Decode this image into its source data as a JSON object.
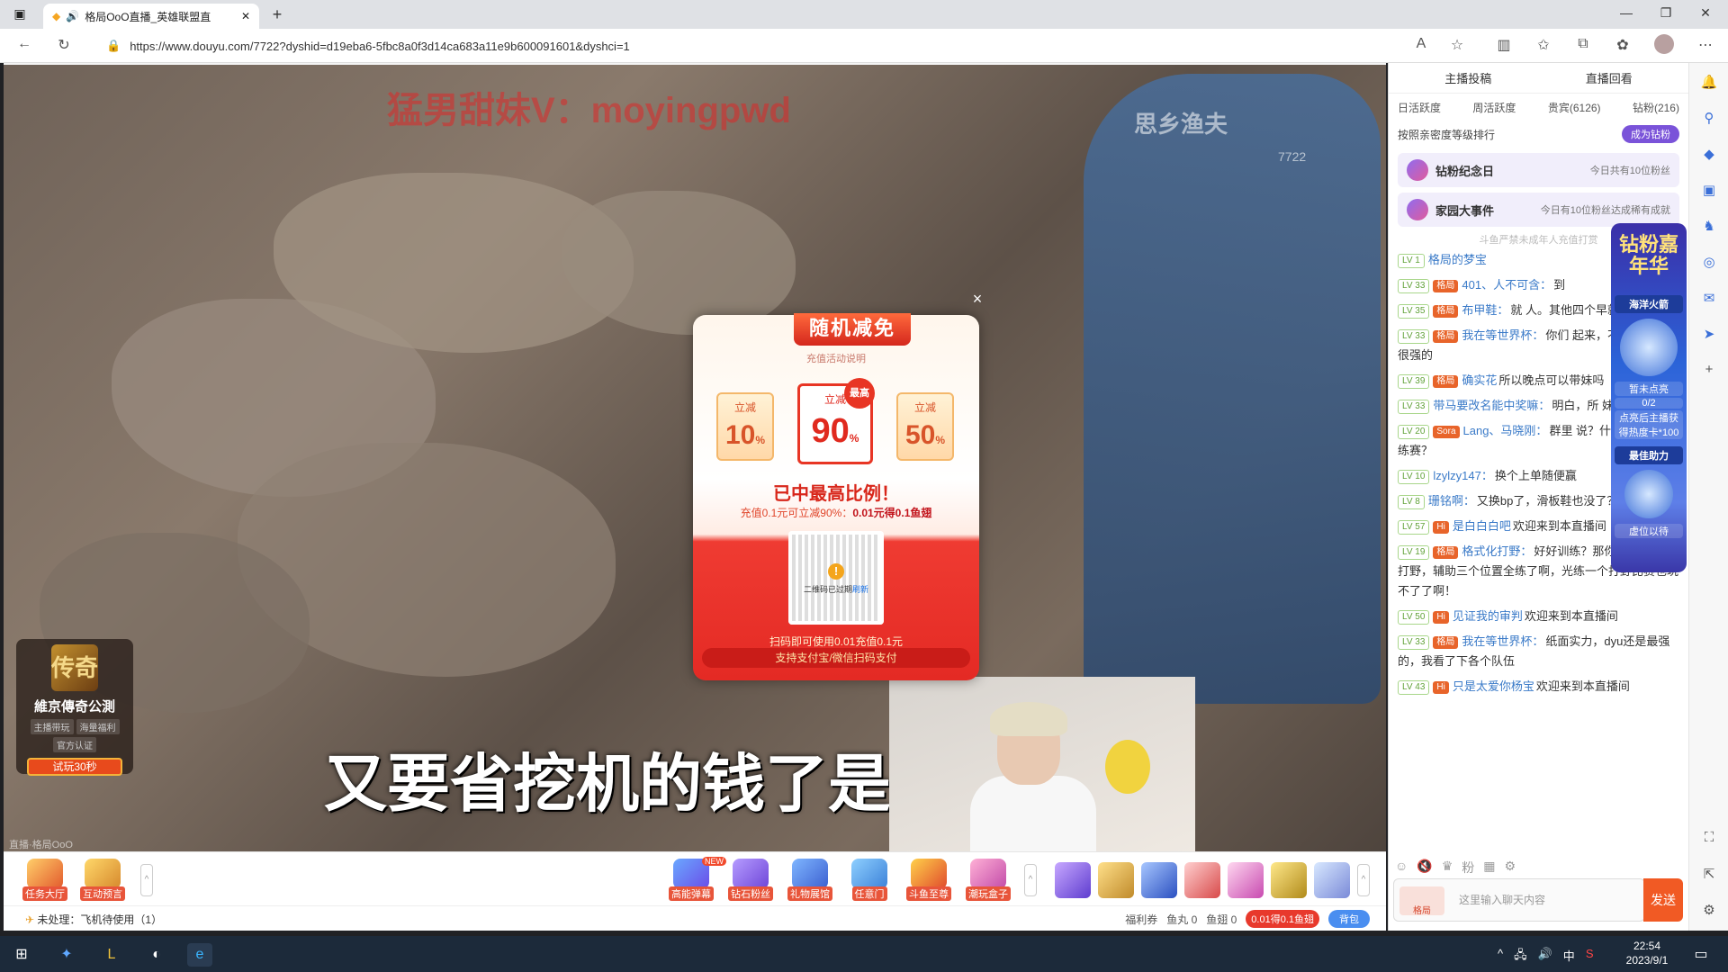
{
  "browser": {
    "tab_title": "格局OoO直播_英雄联盟直",
    "new_tab": "+",
    "url": "https://www.douyu.com/7722?dyshid=d19eba6-5fbc8a0f3d14ca683a11e9b600091601&dyshci=1",
    "win_min": "—",
    "win_max": "❐",
    "win_close": "✕"
  },
  "video": {
    "watermark": "猛男甜妹V：moyingpwd",
    "channel_mark": "思乡渔夫",
    "room_id": "7722",
    "subtitle": "又要省挖机的钱了是",
    "corner_tag": "直播·格局OoO"
  },
  "promo": {
    "logo_text": "传奇",
    "name": "維京傳奇公測",
    "tags": [
      "主播带玩",
      "海量福利",
      "官方认证"
    ],
    "try_label": "试玩30秒"
  },
  "modal": {
    "title": "随机减免",
    "subtitle": "充值活动说明",
    "cards": [
      {
        "label": "立减",
        "value": "10",
        "unit": "%"
      },
      {
        "label": "立减",
        "value": "90",
        "unit": "%"
      },
      {
        "label": "立减",
        "value": "50",
        "unit": "%"
      }
    ],
    "best_badge": "最高",
    "result": "已中最高比例！",
    "detail_prefix": "充值0.1元可立减90%：",
    "detail_strong": "0.01元得0.1鱼翅",
    "qr_expired": "二维码已过期",
    "qr_refresh": "刷新",
    "scan_text": "扫码即可使用0.01充值0.1元",
    "pay_text": "支持支付宝/微信扫码支付",
    "close": "×"
  },
  "toolbar": {
    "left_tools": [
      {
        "label": "任务大厅"
      },
      {
        "label": "互动预言"
      }
    ],
    "center_tools": [
      {
        "label": "高能弹幕",
        "badge": "NEW"
      },
      {
        "label": "钻石粉丝"
      },
      {
        "label": "礼物展馆"
      },
      {
        "label": "任意门"
      },
      {
        "label": "斗鱼至尊"
      },
      {
        "label": "潮玩盒子"
      }
    ],
    "status_left": "未处理：飞机待使用（1）",
    "welfare": "福利券",
    "fish_ball": "鱼丸 0",
    "fish_fin": "鱼翅 0",
    "recharge": "0.01得0.1鱼翅",
    "backpack": "背包"
  },
  "panel": {
    "top": [
      "主播投稿",
      "直播回看"
    ],
    "tabs": [
      "日活跃度",
      "周活跃度",
      "贵宾(6126)",
      "钻粉(216)"
    ],
    "rank_label": "按照亲密度等级排行",
    "become_diamond": "成为钻粉",
    "events": [
      {
        "title": "钻粉纪念日",
        "desc": "今日共有10位粉丝"
      },
      {
        "title": "家园大事件",
        "desc": "今日有10位粉丝达成稀有成就"
      }
    ],
    "notice": "斗鱼严禁未成年人充值打赏",
    "chat": [
      {
        "lv": "LV 1",
        "fan": "",
        "nick": "格局的梦宝",
        "text": ""
      },
      {
        "lv": "LV 33",
        "fan": "格局",
        "nick": "401、人不可含：",
        "text": "到"
      },
      {
        "lv": "LV 35",
        "fan": "格局",
        "nick": "布甲鞋：",
        "text": "就 人。其他四个早就无所谓了"
      },
      {
        "lv": "LV 33",
        "fan": "格局",
        "nick": "我在等世界杯：",
        "text": "你们 起来，不内江，还是很强的"
      },
      {
        "lv": "LV 39",
        "fan": "格局",
        "nick": "确实花",
        "text": "所以晚点可以带妹吗"
      },
      {
        "lv": "LV 33",
        "fan": "",
        "nick": "带马要改名能中奖嘛：",
        "text": "明白，所 妹吗"
      },
      {
        "lv": "LV 20",
        "fan": "Sora",
        "nick": "Lang、马晓刚：",
        "text": "群里 说？什么时候打训练赛？"
      },
      {
        "lv": "LV 10",
        "fan": "",
        "nick": "lzylzy147：",
        "text": "换个上单随便赢"
      },
      {
        "lv": "LV 8",
        "fan": "",
        "nick": "珊铭啊：",
        "text": "又换bp了，滑板鞋也没了？"
      },
      {
        "lv": "LV 57",
        "fan": "Hi",
        "nick": "是白白白吧",
        "text": "欢迎来到本直播间"
      },
      {
        "lv": "LV 19",
        "fan": "格局",
        "nick": "格式化打野：",
        "text": "好好训练？那你不得把ad，打野，辅助三个位置全练了啊，光练一个打野比赛也玩不了了啊！"
      },
      {
        "lv": "LV 50",
        "fan": "Hi",
        "nick": "见证我的审判",
        "text": "欢迎来到本直播间"
      },
      {
        "lv": "LV 33",
        "fan": "格局",
        "nick": "我在等世界杯：",
        "text": "纸面实力，dyu还是最强的，我看了下各个队伍"
      },
      {
        "lv": "LV 43",
        "fan": "Hi",
        "nick": "只是太爱你杨宝",
        "text": "欢迎来到本直播间"
      }
    ],
    "input_placeholder": "这里输入聊天内容",
    "fan_badge": "格局",
    "send": "发送"
  },
  "float_banner": {
    "title": "钻粉嘉年华",
    "section": "海洋火箭",
    "status": "暂未点亮",
    "progress": "0/2",
    "hint": "点亮后主播获得热度卡*100",
    "helper": "最佳助力",
    "seat": "虚位以待"
  },
  "taskbar": {
    "time": "22:54",
    "date": "2023/9/1",
    "ime": "中"
  }
}
